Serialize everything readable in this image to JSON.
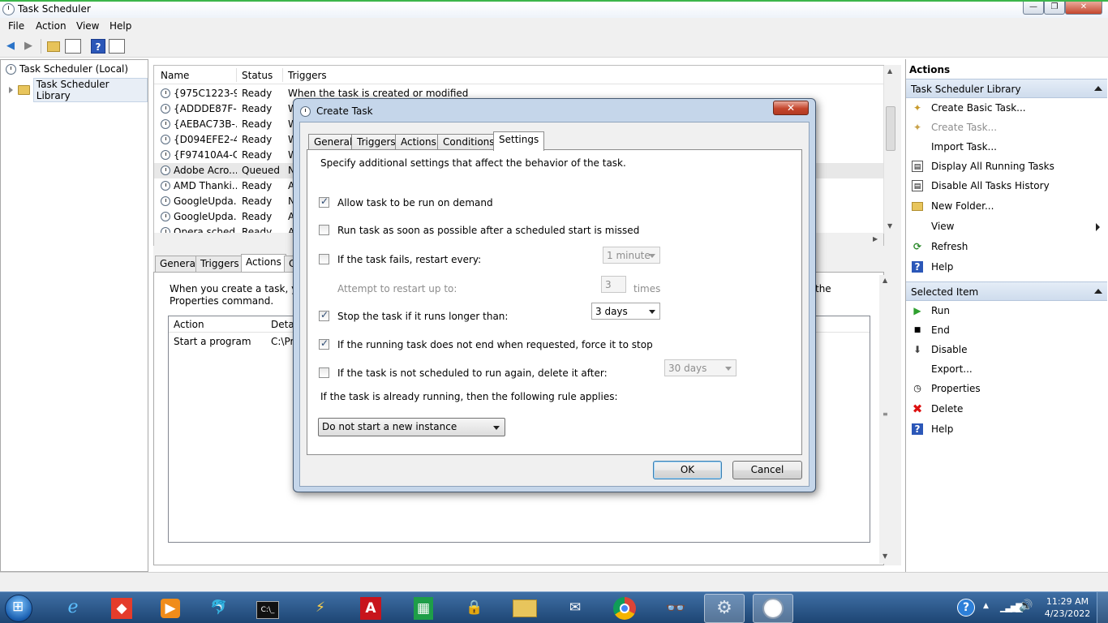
{
  "window": {
    "title": "Task Scheduler",
    "min": "—",
    "max": "❐",
    "close": "✕"
  },
  "menu": [
    "File",
    "Action",
    "View",
    "Help"
  ],
  "tree": {
    "root": "Task Scheduler (Local)",
    "child": "Task Scheduler Library"
  },
  "task_list": {
    "columns": [
      "Name",
      "Status",
      "Triggers"
    ],
    "rows": [
      {
        "name": "{975C1223-9...",
        "status": "Ready",
        "trigger": "When the task is created or modified"
      },
      {
        "name": "{ADDDE87F-...",
        "status": "Ready",
        "trigger": "W"
      },
      {
        "name": "{AEBAC73B-...",
        "status": "Ready",
        "trigger": "W"
      },
      {
        "name": "{D094EFE2-4...",
        "status": "Ready",
        "trigger": "W"
      },
      {
        "name": "{F97410A4-C...",
        "status": "Ready",
        "trigger": "W"
      },
      {
        "name": "Adobe Acro...",
        "status": "Queued",
        "trigger": "N"
      },
      {
        "name": "AMD Thanki...",
        "status": "Ready",
        "trigger": "A"
      },
      {
        "name": "GoogleUpda...",
        "status": "Ready",
        "trigger": "N"
      },
      {
        "name": "GoogleUpda...",
        "status": "Ready",
        "trigger": "A"
      },
      {
        "name": "Opera sched...",
        "status": "Ready",
        "trigger": "A"
      }
    ]
  },
  "detail": {
    "tabs": [
      "General",
      "Triggers",
      "Actions",
      "C"
    ],
    "description_line1": "When you create a task, you",
    "description_line2": "Properties command.",
    "description_right": "the",
    "action_columns": [
      "Action",
      "Detai"
    ],
    "action_row": {
      "action": "Start a program",
      "details": "C:\\Pr"
    }
  },
  "actions_pane": {
    "title": "Actions",
    "section1": "Task Scheduler Library",
    "items1": [
      {
        "label": "Create Basic Task...",
        "icon": "create-basic-task-icon",
        "enabled": true
      },
      {
        "label": "Create Task...",
        "icon": "create-task-icon",
        "enabled": false
      },
      {
        "label": "Import Task...",
        "icon": "",
        "enabled": true
      },
      {
        "label": "Display All Running Tasks",
        "icon": "running-tasks-icon",
        "enabled": true
      },
      {
        "label": "Disable All Tasks History",
        "icon": "tasks-history-icon",
        "enabled": true
      },
      {
        "label": "New Folder...",
        "icon": "new-folder-icon",
        "enabled": true
      },
      {
        "label": "View",
        "icon": "",
        "enabled": true
      },
      {
        "label": "Refresh",
        "icon": "refresh-icon",
        "enabled": true
      },
      {
        "label": "Help",
        "icon": "help-icon",
        "enabled": true
      }
    ],
    "section2": "Selected Item",
    "items2": [
      {
        "label": "Run",
        "icon": "run-icon",
        "enabled": true
      },
      {
        "label": "End",
        "icon": "end-icon",
        "enabled": true
      },
      {
        "label": "Disable",
        "icon": "disable-icon",
        "enabled": true
      },
      {
        "label": "Export...",
        "icon": "",
        "enabled": true
      },
      {
        "label": "Properties",
        "icon": "properties-icon",
        "enabled": true
      },
      {
        "label": "Delete",
        "icon": "delete-icon",
        "enabled": true
      },
      {
        "label": "Help",
        "icon": "help-icon",
        "enabled": true
      }
    ]
  },
  "dialog": {
    "title": "Create Task",
    "close": "✕",
    "tabs": [
      "General",
      "Triggers",
      "Actions",
      "Conditions",
      "Settings"
    ],
    "active_tab": "Settings",
    "intro": "Specify additional settings that affect the behavior of the task.",
    "options": {
      "allow_on_demand": {
        "label": "Allow task to be run on demand",
        "checked": true
      },
      "run_asap": {
        "label": "Run task as soon as possible after a scheduled start is missed",
        "checked": false
      },
      "restart_every": {
        "label": "If the task fails, restart every:",
        "checked": false,
        "value": "1 minute"
      },
      "restart_attempts": {
        "label": "Attempt to restart up to:",
        "value": "3",
        "unit": "times"
      },
      "stop_longer": {
        "label": "Stop the task if it runs longer than:",
        "checked": true,
        "value": "3 days"
      },
      "force_stop": {
        "label": "If the running task does not end when requested, force it to stop",
        "checked": true
      },
      "delete_after": {
        "label": "If the task is not scheduled to run again, delete it after:",
        "checked": false,
        "value": "30 days"
      }
    },
    "rule_label": "If the task is already running, then the following rule applies:",
    "rule_value": "Do not start a new instance",
    "ok": "OK",
    "cancel": "Cancel"
  },
  "taskbar": {
    "time": "11:29 AM",
    "date": "4/23/2022"
  }
}
